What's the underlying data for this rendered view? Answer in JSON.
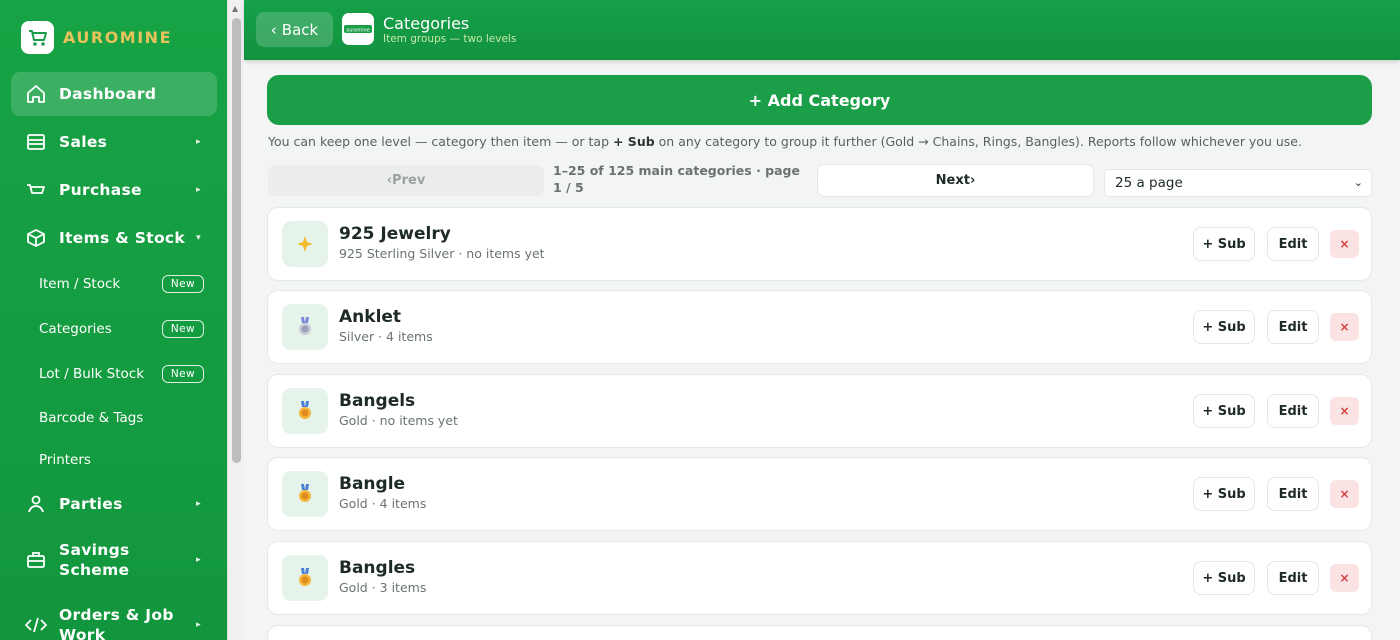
{
  "brand": {
    "name": "AUROMINE"
  },
  "sidebar": {
    "items": [
      {
        "label": "Dashboard",
        "icon": "home-icon"
      },
      {
        "label": "Sales",
        "icon": "receipt-icon"
      },
      {
        "label": "Purchase",
        "icon": "cart-icon"
      },
      {
        "label": "Items & Stock",
        "icon": "box-icon"
      },
      {
        "label": "Parties",
        "icon": "user-icon"
      },
      {
        "label": "Savings Scheme",
        "icon": "briefcase-icon"
      },
      {
        "label": "Orders & Job Work",
        "icon": "code-icon"
      }
    ],
    "subitems": [
      {
        "label": "Item / Stock",
        "badge": "New"
      },
      {
        "label": "Categories",
        "badge": "New"
      },
      {
        "label": "Lot / Bulk Stock",
        "badge": "New"
      },
      {
        "label": "Barcode & Tags"
      },
      {
        "label": "Printers"
      }
    ]
  },
  "header": {
    "back_label": "Back",
    "title": "Categories",
    "subtitle": "Item groups — two levels",
    "logo_text": "auromine"
  },
  "main": {
    "add_label": "+ Add Category",
    "hint_before": "You can keep one level — category then item — or tap ",
    "hint_bold": "+ Sub",
    "hint_after": " on any category to group it further (Gold → Chains, Rings, Bangles). Reports follow whichever you use.",
    "pager": {
      "prev": "‹Prev",
      "info": "1–25 of 125 main categories · page 1 / 5",
      "next": "Next›",
      "page_size": "25 a page"
    },
    "categories": [
      {
        "name": "925 Jewelry",
        "meta": "925 Sterling Silver · no items yet",
        "icon": "sparkle-icon"
      },
      {
        "name": "Anklet",
        "meta": "Silver · 4 items",
        "icon": "silver-medal-icon"
      },
      {
        "name": "Bangels",
        "meta": "Gold · no items yet",
        "icon": "gold-medal-icon"
      },
      {
        "name": "Bangle",
        "meta": "Gold · 4 items",
        "icon": "gold-medal-icon"
      },
      {
        "name": "Bangles",
        "meta": "Gold · 3 items",
        "icon": "gold-medal-icon"
      }
    ],
    "sub_label": "+ Sub",
    "edit_label": "Edit",
    "delete_label": "×"
  },
  "colors": {
    "primary": "#1a9e48",
    "gold": "#e8c25a",
    "danger_bg": "#fbe3e3"
  }
}
